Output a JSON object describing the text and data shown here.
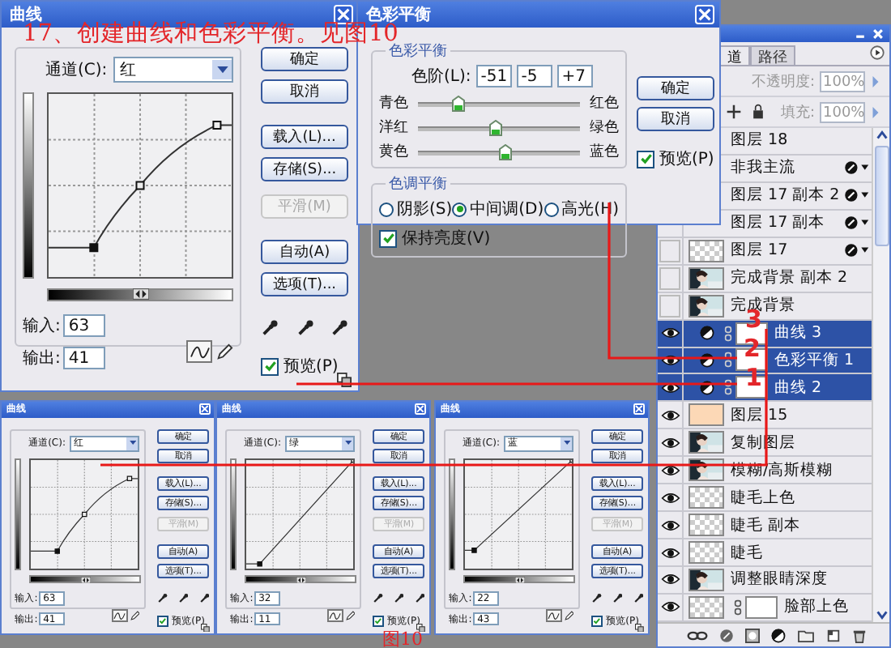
{
  "curves_dialog": {
    "title": "曲线",
    "channel_label": "通道(C):",
    "channel": "红",
    "kind": "arched",
    "input_label": "输入:",
    "input": "63",
    "output_label": "输出:",
    "output": "41",
    "buttons": [
      {
        "label": "确定",
        "disabled": false
      },
      {
        "label": "取消",
        "disabled": false
      },
      {
        "label": "载入(L)...",
        "disabled": false
      },
      {
        "label": "存储(S)...",
        "disabled": false
      },
      {
        "label": "平滑(M)",
        "disabled": true
      },
      {
        "label": "自动(A)",
        "disabled": false
      },
      {
        "label": "选项(T)...",
        "disabled": false
      }
    ],
    "preview": {
      "label": "预览(P)",
      "checked": true
    }
  },
  "color_balance": {
    "title": "色彩平衡",
    "balance_group": "色彩平衡",
    "levels_label": "色阶(L):",
    "levels": [
      "-51",
      "-5",
      "+7"
    ],
    "sliders": [
      {
        "left": "青色",
        "right": "红色",
        "level": 0.245
      },
      {
        "left": "洋红",
        "right": "绿色",
        "level": 0.475
      },
      {
        "left": "黄色",
        "right": "蓝色",
        "level": 0.535
      }
    ],
    "tone_group": "色调平衡",
    "tones": [
      {
        "label": "阴影(S)",
        "selected": false
      },
      {
        "label": "中间调(D)",
        "selected": true
      },
      {
        "label": "高光(H)",
        "selected": false
      }
    ],
    "preserve": {
      "label": "保持亮度(V)",
      "checked": true
    },
    "buttons": [
      {
        "label": "确定"
      },
      {
        "label": "取消"
      }
    ],
    "preview": {
      "label": "预览(P)",
      "checked": true
    }
  },
  "layers_panel": {
    "tabs": [
      {
        "label": "道",
        "selected": true
      },
      {
        "label": "路径",
        "selected": false
      }
    ],
    "opacity_label": "不透明度:",
    "opacity": "100%",
    "fill_label": "填充:",
    "fill": "100%",
    "layers": [
      {
        "name": "图层 18",
        "selected": false
      },
      {
        "name": "非我主流",
        "selected": false,
        "effects": true
      },
      {
        "name": "图层 17 副本 2",
        "selected": false,
        "effects": true
      },
      {
        "name": "图层 17 副本",
        "selected": false,
        "effects": true
      },
      {
        "name": "图层 17",
        "selected": false,
        "visible": false,
        "kind": "transparent",
        "effects": true
      },
      {
        "name": "完成背景 副本 2",
        "selected": false,
        "visible": false
      },
      {
        "name": "完成背景",
        "selected": false,
        "visible": false
      },
      {
        "name": "曲线 3",
        "selected": true,
        "visible": true,
        "kind": "adjustment"
      },
      {
        "name": "色彩平衡 1",
        "selected": true,
        "visible": true,
        "kind": "adjustment"
      },
      {
        "name": "曲线 2",
        "selected": true,
        "visible": true,
        "kind": "adjustment"
      },
      {
        "name": "图层 15",
        "selected": false,
        "visible": true,
        "kind": "solid",
        "color": "#fcd8b6"
      },
      {
        "name": "复制图层",
        "selected": false,
        "visible": true
      },
      {
        "name": "模糊/高斯模糊",
        "selected": false,
        "visible": true
      },
      {
        "name": "睫毛上色",
        "selected": false,
        "visible": true,
        "kind": "transparent"
      },
      {
        "name": "睫毛 副本",
        "selected": false,
        "visible": true,
        "kind": "transparent"
      },
      {
        "name": "睫毛",
        "selected": false,
        "visible": true,
        "kind": "transparent"
      },
      {
        "name": "调整眼睛深度",
        "selected": false,
        "visible": true
      },
      {
        "name": "脸部上色",
        "selected": false,
        "visible": true,
        "kind": "masked"
      }
    ]
  },
  "figure_10": [
    {
      "title": "曲线",
      "channel_label": "通道(C):",
      "channel": "红",
      "kind": "arched",
      "input_label": "输入:",
      "input": "63",
      "output_label": "输出:",
      "output": "41",
      "buttons": [
        {
          "label": "确定",
          "disabled": false
        },
        {
          "label": "取消",
          "disabled": false
        },
        {
          "label": "载入(L)...",
          "disabled": false
        },
        {
          "label": "存储(S)...",
          "disabled": false
        },
        {
          "label": "平滑(M)",
          "disabled": true
        },
        {
          "label": "自动(A)",
          "disabled": false
        },
        {
          "label": "选项(T)...",
          "disabled": false
        }
      ],
      "preview": {
        "label": "预览(P)",
        "checked": true
      }
    },
    {
      "title": "曲线",
      "channel_label": "通道(C):",
      "channel": "绿",
      "kind": "straight",
      "input_label": "输入:",
      "input": "32",
      "output_label": "输出:",
      "output": "11",
      "buttons": [
        {
          "label": "确定",
          "disabled": false
        },
        {
          "label": "取消",
          "disabled": false
        },
        {
          "label": "载入(L)...",
          "disabled": false
        },
        {
          "label": "存储(S)...",
          "disabled": false
        },
        {
          "label": "平滑(M)",
          "disabled": true
        },
        {
          "label": "自动(A)",
          "disabled": false
        },
        {
          "label": "选项(T)...",
          "disabled": false
        }
      ],
      "preview": {
        "label": "预览(P)",
        "checked": true
      }
    },
    {
      "title": "曲线",
      "channel_label": "通道(C):",
      "channel": "蓝",
      "kind": "straight",
      "input_label": "输入:",
      "input": "22",
      "output_label": "输出:",
      "output": "43",
      "buttons": [
        {
          "label": "确定",
          "disabled": false
        },
        {
          "label": "取消",
          "disabled": false
        },
        {
          "label": "载入(L)...",
          "disabled": false
        },
        {
          "label": "存储(S)...",
          "disabled": false
        },
        {
          "label": "平滑(M)",
          "disabled": true
        },
        {
          "label": "自动(A)",
          "disabled": false
        },
        {
          "label": "选项(T)...",
          "disabled": false
        }
      ],
      "preview": {
        "label": "预览(P)",
        "checked": true
      }
    }
  ],
  "annotations": {
    "caption": "17、创建曲线和色彩平衡。见图10",
    "figure_label": "图10",
    "markers": [
      "3",
      "2",
      "1"
    ]
  }
}
